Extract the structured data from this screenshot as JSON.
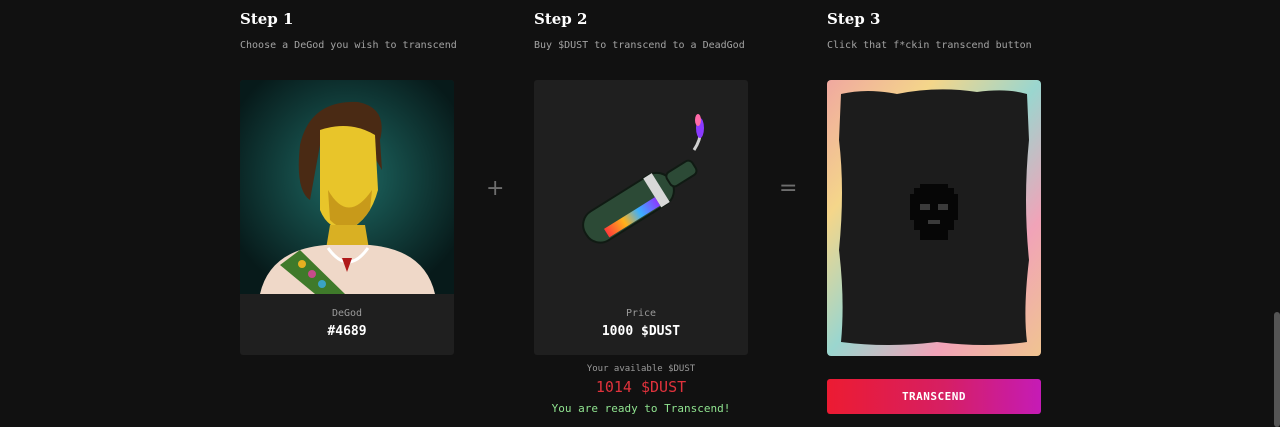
{
  "steps": [
    {
      "title": "Step 1",
      "subtitle": "Choose a DeGod you wish to transcend"
    },
    {
      "title": "Step 2",
      "subtitle": "Buy $DUST to transcend to a DeadGod"
    },
    {
      "title": "Step 3",
      "subtitle": "Click that f*ckin transcend button"
    }
  ],
  "degod_card": {
    "label": "DeGod",
    "value": "#4689"
  },
  "dust_card": {
    "label": "Price",
    "value": "1000 $DUST"
  },
  "operators": {
    "plus": "+",
    "equals": "="
  },
  "balance": {
    "label": "Your available $DUST",
    "value": "1014 $DUST",
    "status": "You are ready to Transcend!"
  },
  "transcend_button": "TRANSCEND",
  "colors": {
    "accent_red": "#e0323c",
    "ready_green": "#8fe28f",
    "button_start": "#ec1b32",
    "button_end": "#c51bb6"
  },
  "icons": {
    "degod": "degod-portrait",
    "bottle": "dust-bottle",
    "deadgod": "deadgod-pixel-skull"
  }
}
